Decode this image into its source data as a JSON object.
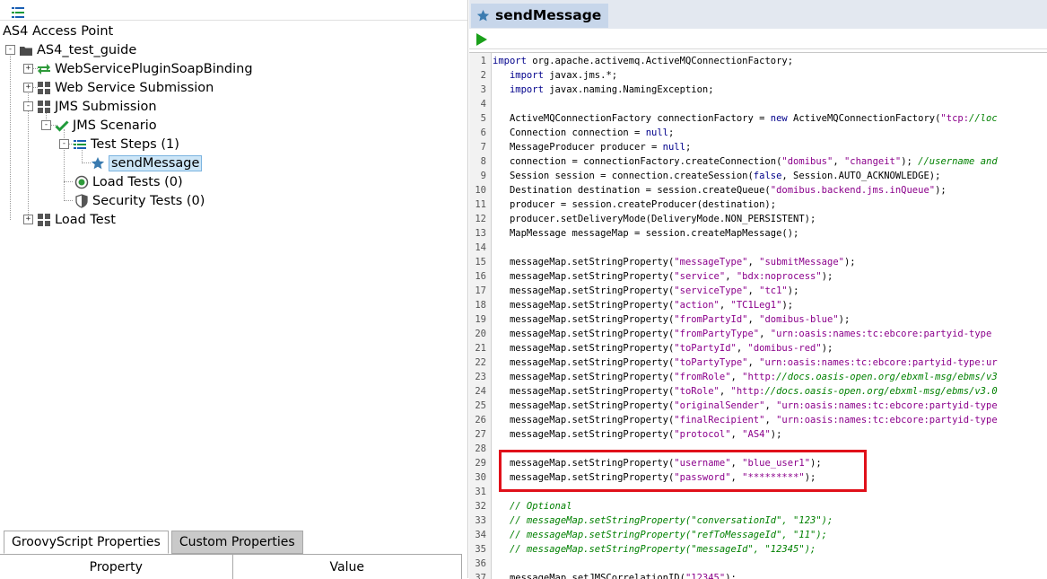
{
  "navigator": {
    "root_label": "AS4 Access Point",
    "tree": [
      {
        "label": "AS4_test_guide",
        "level": 0,
        "icon": "folder-icon",
        "expander": "-"
      },
      {
        "label": "WebServicePluginSoapBinding",
        "level": 1,
        "icon": "swap-arrows-icon",
        "expander": "+"
      },
      {
        "label": "Web Service Submission",
        "level": 1,
        "icon": "grid-icon",
        "expander": "+"
      },
      {
        "label": "JMS Submission",
        "level": 1,
        "icon": "grid-icon",
        "expander": "-"
      },
      {
        "label": "JMS Scenario",
        "level": 2,
        "icon": "checkmark-icon",
        "expander": "-"
      },
      {
        "label": "Test Steps (1)",
        "level": 3,
        "icon": "list-icon",
        "expander": "-"
      },
      {
        "label": "sendMessage",
        "level": 4,
        "icon": "star-icon",
        "expander": "",
        "selected": true
      },
      {
        "label": "Load Tests (0)",
        "level": 3,
        "icon": "gauge-icon",
        "expander": ""
      },
      {
        "label": "Security Tests (0)",
        "level": 3,
        "icon": "shield-icon",
        "expander": ""
      },
      {
        "label": "Load Test",
        "level": 1,
        "icon": "grid-icon",
        "expander": "+"
      }
    ]
  },
  "properties": {
    "tabs": [
      {
        "label": "GroovyScript Properties",
        "active": true
      },
      {
        "label": "Custom Properties",
        "active": false
      }
    ],
    "columns": [
      "Property",
      "Value"
    ]
  },
  "editor": {
    "title": "sendMessage",
    "lines": [
      {
        "n": "1",
        "t": "import org.apache.activemq.ActiveMQConnectionFactory;"
      },
      {
        "n": "2",
        "t": "   import javax.jms.*;"
      },
      {
        "n": "3",
        "t": "   import javax.naming.NamingException;"
      },
      {
        "n": "4",
        "t": ""
      },
      {
        "n": "5",
        "t": "   ActiveMQConnectionFactory connectionFactory = new ActiveMQConnectionFactory(\"tcp://loc"
      },
      {
        "n": "6",
        "t": "   Connection connection = null;"
      },
      {
        "n": "7",
        "t": "   MessageProducer producer = null;"
      },
      {
        "n": "8",
        "t": "   connection = connectionFactory.createConnection(\"domibus\", \"changeit\"); //username and"
      },
      {
        "n": "9",
        "t": "   Session session = connection.createSession(false, Session.AUTO_ACKNOWLEDGE);"
      },
      {
        "n": "10",
        "t": "   Destination destination = session.createQueue(\"domibus.backend.jms.inQueue\");"
      },
      {
        "n": "11",
        "t": "   producer = session.createProducer(destination);"
      },
      {
        "n": "12",
        "t": "   producer.setDeliveryMode(DeliveryMode.NON_PERSISTENT);"
      },
      {
        "n": "13",
        "t": "   MapMessage messageMap = session.createMapMessage();"
      },
      {
        "n": "14",
        "t": ""
      },
      {
        "n": "15",
        "t": "   messageMap.setStringProperty(\"messageType\", \"submitMessage\");"
      },
      {
        "n": "16",
        "t": "   messageMap.setStringProperty(\"service\", \"bdx:noprocess\");"
      },
      {
        "n": "17",
        "t": "   messageMap.setStringProperty(\"serviceType\", \"tc1\");"
      },
      {
        "n": "18",
        "t": "   messageMap.setStringProperty(\"action\", \"TC1Leg1\");"
      },
      {
        "n": "19",
        "t": "   messageMap.setStringProperty(\"fromPartyId\", \"domibus-blue\");"
      },
      {
        "n": "20",
        "t": "   messageMap.setStringProperty(\"fromPartyType\", \"urn:oasis:names:tc:ebcore:partyid-type"
      },
      {
        "n": "21",
        "t": "   messageMap.setStringProperty(\"toPartyId\", \"domibus-red\");"
      },
      {
        "n": "22",
        "t": "   messageMap.setStringProperty(\"toPartyType\", \"urn:oasis:names:tc:ebcore:partyid-type:ur"
      },
      {
        "n": "23",
        "t": "   messageMap.setStringProperty(\"fromRole\", \"http://docs.oasis-open.org/ebxml-msg/ebms/v3"
      },
      {
        "n": "24",
        "t": "   messageMap.setStringProperty(\"toRole\", \"http://docs.oasis-open.org/ebxml-msg/ebms/v3.0"
      },
      {
        "n": "25",
        "t": "   messageMap.setStringProperty(\"originalSender\", \"urn:oasis:names:tc:ebcore:partyid-type"
      },
      {
        "n": "26",
        "t": "   messageMap.setStringProperty(\"finalRecipient\", \"urn:oasis:names:tc:ebcore:partyid-type"
      },
      {
        "n": "27",
        "t": "   messageMap.setStringProperty(\"protocol\", \"AS4\");"
      },
      {
        "n": "28",
        "t": ""
      },
      {
        "n": "29",
        "t": "   messageMap.setStringProperty(\"username\", \"blue_user1\");"
      },
      {
        "n": "30",
        "t": "   messageMap.setStringProperty(\"password\", \"*********\");"
      },
      {
        "n": "31",
        "t": ""
      },
      {
        "n": "32",
        "t": "   // Optional"
      },
      {
        "n": "33",
        "t": "   // messageMap.setStringProperty(\"conversationId\", \"123\");"
      },
      {
        "n": "34",
        "t": "   // messageMap.setStringProperty(\"refToMessageId\", \"11\");"
      },
      {
        "n": "35",
        "t": "   // messageMap.setStringProperty(\"messageId\", \"12345\");"
      },
      {
        "n": "36",
        "t": ""
      },
      {
        "n": "37",
        "t": "   messageMap.setJMSCorrelationID(\"12345\");"
      }
    ]
  },
  "colors": {
    "highlight_box": "#e0101a",
    "run_button": "#1aa01a",
    "selection": "#cde6f7",
    "keyword": "#00008b",
    "string": "#8b008b",
    "comment": "#008000"
  }
}
